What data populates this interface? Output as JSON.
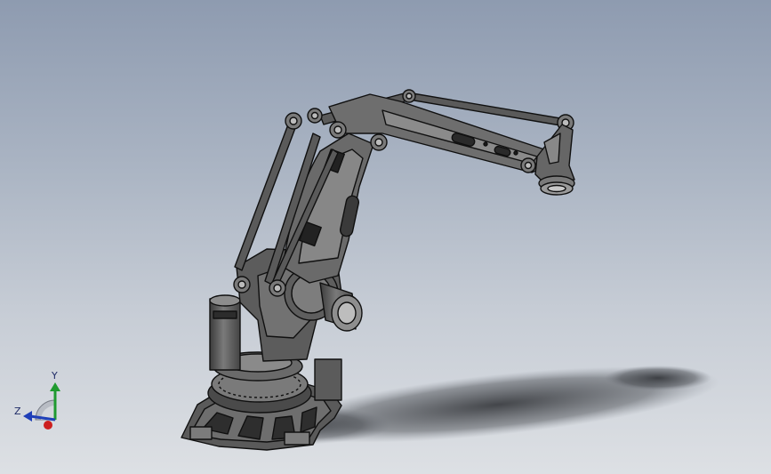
{
  "viewport": {
    "model_name": "palletizing-robot",
    "background_top": "#8e9bb0",
    "background_bottom": "#dde0e4",
    "model_color": "#5f5f5f",
    "edge_color": "#101010"
  },
  "triad": {
    "x_label": "",
    "y_label": "Y",
    "z_label": "Z",
    "x_color": "#cc1f1f",
    "y_color": "#1f9a2f",
    "z_color": "#1f3fb8"
  }
}
